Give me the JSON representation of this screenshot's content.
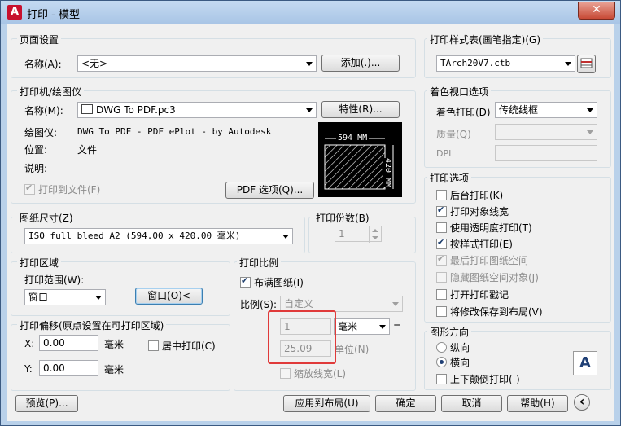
{
  "window": {
    "title": "打印 - 模型",
    "app_icon": "A",
    "close": "✕"
  },
  "page_setup": {
    "title": "页面设置",
    "name_label": "名称(A):",
    "name_value": "<无>",
    "add_button": "添加(.)..."
  },
  "plotter": {
    "title": "打印机/绘图仪",
    "name_label": "名称(M):",
    "name_value": "DWG To PDF.pc3",
    "properties_button": "特性(R)...",
    "plotter_label": "绘图仪:",
    "plotter_value": "DWG To PDF - PDF ePlot - by Autodesk",
    "location_label": "位置:",
    "location_value": "文件",
    "desc_label": "说明:",
    "plot_to_file": "打印到文件(F)",
    "pdf_options_button": "PDF 选项(Q)...",
    "preview_width": "594 MM",
    "preview_height": "420 MM"
  },
  "paper_size": {
    "title": "图纸尺寸(Z)",
    "value": "ISO full bleed A2 (594.00 x 420.00 毫米)"
  },
  "copies": {
    "title": "打印份数(B)",
    "value": "1"
  },
  "plot_area": {
    "title": "打印区域",
    "range_label": "打印范围(W):",
    "range_value": "窗口",
    "window_button": "窗口(O)<"
  },
  "plot_offset": {
    "title": "打印偏移(原点设置在可打印区域)",
    "x_label": "X:",
    "x_value": "0.00",
    "x_unit": "毫米",
    "y_label": "Y:",
    "y_value": "0.00",
    "y_unit": "毫米",
    "center": "居中打印(C)"
  },
  "plot_scale": {
    "title": "打印比例",
    "fit_paper": "布满图纸(I)",
    "scale_label": "比例(S):",
    "scale_value": "自定义",
    "value1": "1",
    "unit_value": "毫米",
    "equals": "=",
    "value2": "25.09",
    "unit2_label": "单位(N)",
    "scale_lineweights": "缩放线宽(L)"
  },
  "plot_style": {
    "title": "打印样式表(画笔指定)(G)",
    "value": "TArch20V7.ctb"
  },
  "shaded_viewport": {
    "title": "着色视口选项",
    "shade_label": "着色打印(D)",
    "shade_value": "传统线框",
    "quality_label": "质量(Q)",
    "dpi_label": "DPI"
  },
  "plot_options": {
    "title": "打印选项",
    "items": [
      "后台打印(K)",
      "打印对象线宽",
      "使用透明度打印(T)",
      "按样式打印(E)",
      "最后打印图纸空间",
      "隐藏图纸空间对象(J)",
      "打开打印戳记",
      "将修改保存到布局(V)"
    ]
  },
  "orientation": {
    "title": "图形方向",
    "portrait": "纵向",
    "landscape": "横向",
    "upside_down": "上下颠倒打印(-)",
    "icon_letter": "A"
  },
  "buttons": {
    "preview": "预览(P)...",
    "apply": "应用到布局(U)",
    "ok": "确定",
    "cancel": "取消",
    "help": "帮助(H)",
    "collapse": "‹"
  },
  "colors": {
    "accent": "#1f3f75",
    "highlight": "#e03a3a",
    "background": "#f0f0f0"
  }
}
